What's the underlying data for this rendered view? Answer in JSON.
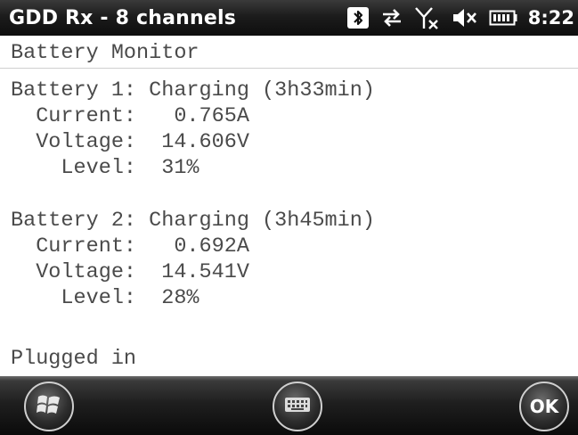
{
  "statusbar": {
    "title": "GDD Rx - 8 channels",
    "time": "8:22",
    "icons": [
      "bluetooth-icon",
      "data-sync-icon",
      "no-signal-icon",
      "volume-muted-icon",
      "battery-icon"
    ]
  },
  "content": {
    "header": "Battery Monitor",
    "battery1": {
      "status": "Battery 1: Charging (3h33min)",
      "current": "  Current:   0.765A",
      "voltage": "  Voltage:  14.606V",
      "level": "    Level:  31%"
    },
    "battery2": {
      "status": "Battery 2: Charging (3h45min)",
      "current": "  Current:   0.692A",
      "voltage": "  Voltage:  14.541V",
      "level": "    Level:  28%"
    },
    "power_status": "Plugged in"
  },
  "softkeys": {
    "left_icon": "windows-start-icon",
    "center_icon": "keyboard-icon",
    "right_label": "OK"
  },
  "colors": {
    "bar_dark": "#111111",
    "text": "#4a4a4a"
  }
}
